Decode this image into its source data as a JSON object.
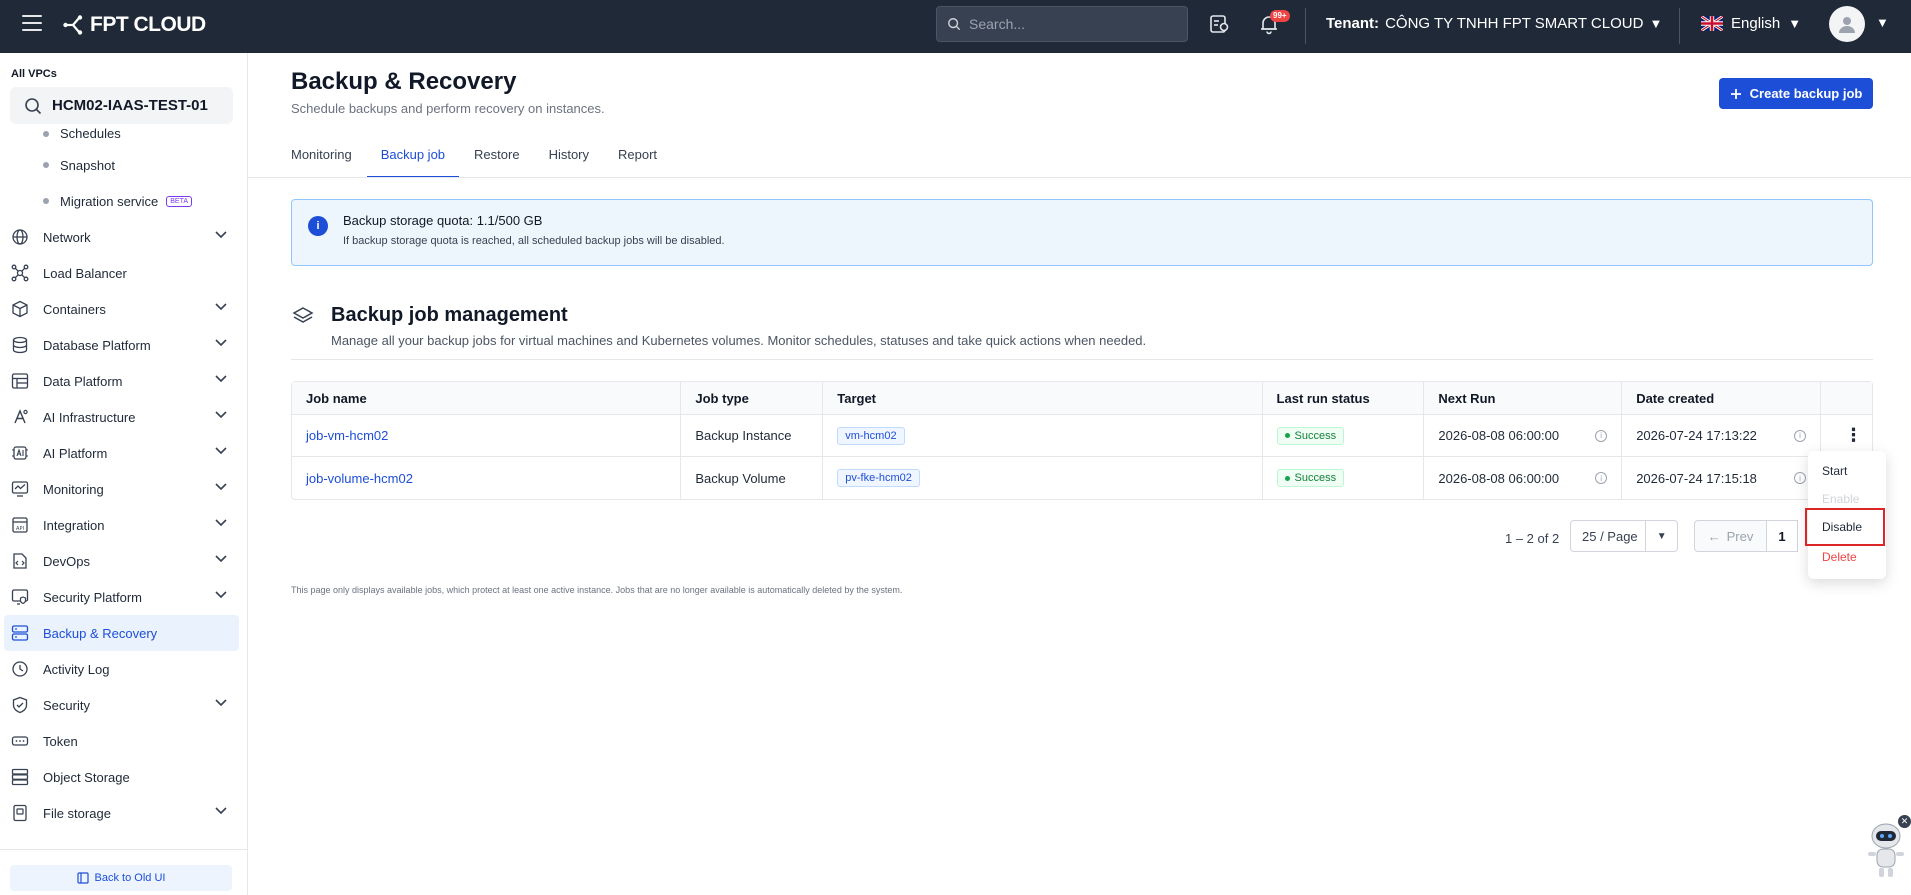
{
  "topbar": {
    "logo_text": "FPT CLOUD",
    "search_placeholder": "Search...",
    "notif_badge": "99+",
    "tenant_label": "Tenant:",
    "tenant_value": "CÔNG TY TNHH FPT SMART CLOUD",
    "language": "English"
  },
  "sidebar": {
    "vpc_label": "All VPCs",
    "vpc_value": "HCM02-IAAS-TEST-01",
    "sub_items": [
      {
        "label": "Schedules"
      },
      {
        "label": "Snapshot"
      },
      {
        "label": "Migration service",
        "badge": "BETA"
      }
    ],
    "items": [
      {
        "label": "Network",
        "icon": "globe-icon",
        "expandable": true
      },
      {
        "label": "Load Balancer",
        "icon": "load-balancer-icon",
        "expandable": false
      },
      {
        "label": "Containers",
        "icon": "cube-icon",
        "expandable": true
      },
      {
        "label": "Database Platform",
        "icon": "database-icon",
        "expandable": true
      },
      {
        "label": "Data Platform",
        "icon": "data-platform-icon",
        "expandable": true
      },
      {
        "label": "AI Infrastructure",
        "icon": "ai-infrastructure-icon",
        "expandable": true
      },
      {
        "label": "AI Platform",
        "icon": "ai-platform-icon",
        "expandable": true
      },
      {
        "label": "Monitoring",
        "icon": "monitoring-icon",
        "expandable": true
      },
      {
        "label": "Integration",
        "icon": "integration-icon",
        "expandable": true
      },
      {
        "label": "DevOps",
        "icon": "devops-icon",
        "expandable": true
      },
      {
        "label": "Security Platform",
        "icon": "security-platform-icon",
        "expandable": true
      },
      {
        "label": "Backup & Recovery",
        "icon": "backup-icon",
        "expandable": false,
        "active": true
      },
      {
        "label": "Activity Log",
        "icon": "clock-icon",
        "expandable": false
      },
      {
        "label": "Security",
        "icon": "shield-icon",
        "expandable": true
      },
      {
        "label": "Token",
        "icon": "token-icon",
        "expandable": false
      },
      {
        "label": "Object Storage",
        "icon": "object-storage-icon",
        "expandable": false
      },
      {
        "label": "File storage",
        "icon": "file-storage-icon",
        "expandable": true
      }
    ],
    "back_label": "Back to Old UI"
  },
  "page": {
    "title": "Backup & Recovery",
    "subtitle": "Schedule backups and perform recovery on instances.",
    "create_button": "Create backup job",
    "tabs": [
      {
        "label": "Monitoring"
      },
      {
        "label": "Backup job",
        "active": true
      },
      {
        "label": "Restore"
      },
      {
        "label": "History"
      },
      {
        "label": "Report"
      }
    ]
  },
  "info": {
    "title": "Backup storage quota: 1.1/500 GB",
    "desc": "If backup storage quota is reached, all scheduled backup jobs will be disabled."
  },
  "section": {
    "title": "Backup job management",
    "desc": "Manage all your backup jobs for virtual machines and Kubernetes volumes. Monitor schedules, statuses and take quick actions when needed."
  },
  "table": {
    "headers": [
      "Job name",
      "Job type",
      "Target",
      "Last run status",
      "Next Run",
      "Date created"
    ],
    "rows": [
      {
        "job_name": "job-vm-hcm02",
        "job_type": "Backup Instance",
        "target": "vm-hcm02",
        "status": "Success",
        "next_run": "2026-08-08 06:00:00",
        "date_created": "2026-07-24 17:13:22"
      },
      {
        "job_name": "job-volume-hcm02",
        "job_type": "Backup Volume",
        "target": "pv-fke-hcm02",
        "status": "Success",
        "next_run": "2026-08-08 06:00:00",
        "date_created": "2026-07-24 17:15:18"
      }
    ]
  },
  "pagination": {
    "range": "1 – 2 of 2",
    "page_size": "25 / Page",
    "prev": "Prev",
    "current_page": "1"
  },
  "footnote": "This page only displays available jobs, which protect at least one active instance. Jobs that are no longer available is automatically deleted by the system.",
  "dropdown": {
    "items": [
      {
        "label": "Start"
      },
      {
        "label": "Enable",
        "disabled": true
      },
      {
        "label": "Disable",
        "highlighted": true
      },
      {
        "label": "Delete",
        "danger": true
      }
    ]
  },
  "colors": {
    "topbar": "#1f2937",
    "primary": "#1d4ed8",
    "success": "#15803d",
    "danger": "#ef4444",
    "highlight_border": "#dc2626"
  }
}
